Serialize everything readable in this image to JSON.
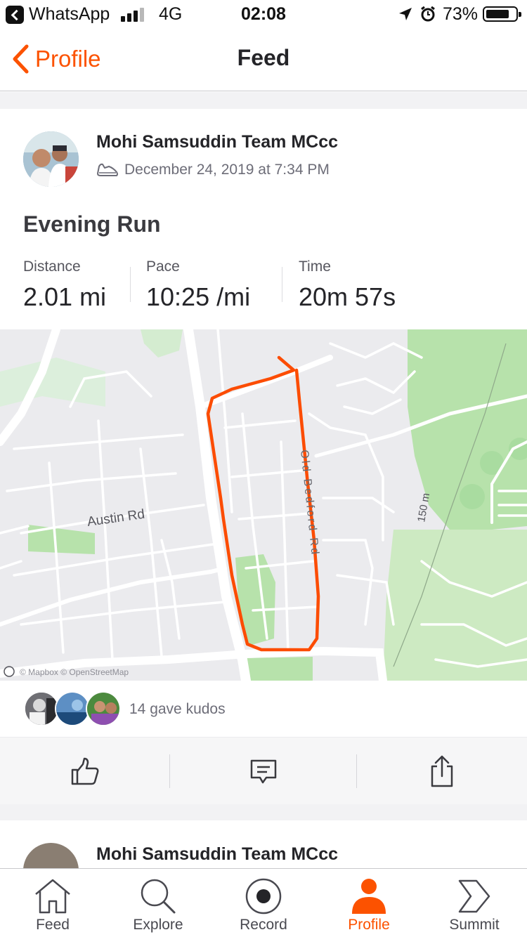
{
  "status_bar": {
    "back_app": "WhatsApp",
    "network": "4G",
    "time": "02:08",
    "battery": "73%",
    "signal_bars_on": 3,
    "signal_bars_total": 4
  },
  "nav": {
    "back_label": "Profile",
    "title": "Feed"
  },
  "activity": {
    "athlete": "Mohi Samsuddin Team MCcc",
    "activity_icon": "shoe-icon",
    "date": "December 24, 2019 at 7:34 PM",
    "title": "Evening Run",
    "stats": [
      {
        "label": "Distance",
        "value": "2.01 mi"
      },
      {
        "label": "Pace",
        "value": "10:25 /mi"
      },
      {
        "label": "Time",
        "value": "20m 57s"
      }
    ],
    "map": {
      "road_label": "Austin Rd",
      "street_label": "Old Bedford Rd",
      "scale_label": "150 m",
      "attribution": "© Mapbox © OpenStreetMap",
      "route_color": "#fc4c02"
    },
    "kudos_text": "14 gave kudos",
    "actions": [
      {
        "name": "kudos",
        "icon": "thumbs-up-icon"
      },
      {
        "name": "comment",
        "icon": "comment-icon"
      },
      {
        "name": "share",
        "icon": "share-icon"
      }
    ]
  },
  "next_activity": {
    "athlete": "Mohi Samsuddin Team MCcc"
  },
  "tabs": [
    {
      "label": "Feed",
      "icon": "home-icon",
      "active": false
    },
    {
      "label": "Explore",
      "icon": "search-icon",
      "active": false
    },
    {
      "label": "Record",
      "icon": "record-icon",
      "active": false
    },
    {
      "label": "Profile",
      "icon": "profile-icon",
      "active": true
    },
    {
      "label": "Summit",
      "icon": "summit-icon",
      "active": false
    }
  ],
  "colors": {
    "accent": "#fc5200",
    "text": "#242428",
    "muted": "#6d6d78",
    "park": "#b7e2ab"
  }
}
